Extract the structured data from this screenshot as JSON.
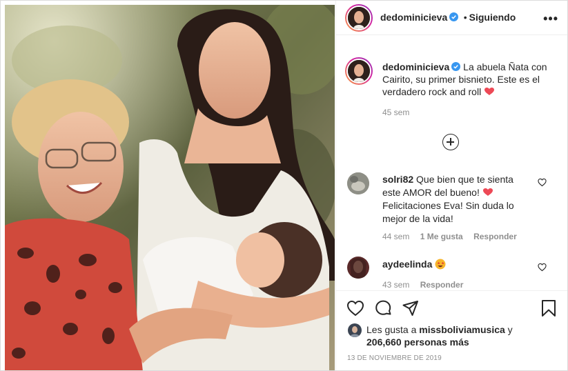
{
  "post": {
    "username": "dedominicieva",
    "follow_status": "Siguiendo",
    "separator": "•",
    "more_label": "•••"
  },
  "caption": {
    "username": "dedominicieva",
    "text": "La abuela Ñata con Cairito, su primer bisnieto. Este es el verdadero rock and roll",
    "time": "45 sem"
  },
  "comments": [
    {
      "username": "solri82",
      "text": "Que bien que te sienta este AMOR del bueno! ",
      "text2": " Felicitaciones Eva! Sin duda lo mejor de la vida!",
      "time": "44 sem",
      "likes": "1 Me gusta",
      "reply": "Responder"
    },
    {
      "username": "aydeelinda",
      "text": "",
      "time": "43 sem",
      "reply": "Responder"
    }
  ],
  "likes": {
    "prefix": "Les gusta a ",
    "user": "missboliviamusica",
    "suffix": " y",
    "count": "206,660 personas más"
  },
  "date": "13 DE NOVIEMBRE DE 2019",
  "colors": {
    "verified_blue": "#3897f0",
    "heart_red": "#ed4956",
    "muted": "#8e8e8e"
  },
  "icons": [
    "verified-badge-icon",
    "more-options-icon",
    "load-more-comments-icon",
    "heart-icon",
    "comment-icon",
    "share-icon",
    "save-icon",
    "red-heart-emoji",
    "star-struck-emoji"
  ]
}
